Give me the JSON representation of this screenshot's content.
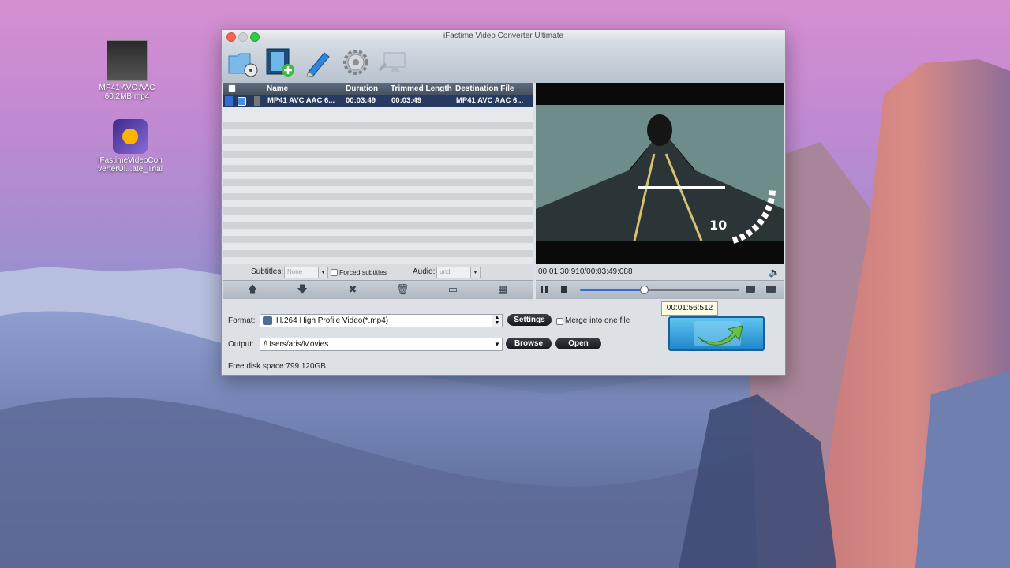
{
  "desktop": {
    "icons": [
      {
        "label": "MP41 AVC AAC\n60.2MB.mp4"
      },
      {
        "label": "iFastimeVideoCon\nverterUl...ate_Trial"
      }
    ]
  },
  "window": {
    "title": "iFastime Video Converter Ultimate",
    "toolbar": [
      {
        "name": "add-folder-icon"
      },
      {
        "name": "add-video-icon"
      },
      {
        "name": "edit-pencil-icon"
      },
      {
        "name": "settings-gear-icon"
      },
      {
        "name": "monitor-icon"
      }
    ],
    "list": {
      "columns": [
        "Name",
        "Duration",
        "Trimmed Length",
        "Destination File"
      ],
      "rows": [
        {
          "name": "MP41 AVC AAC 6...",
          "duration": "00:03:49",
          "trimmed": "00:03:49",
          "destination": "MP41 AVC AAC 6..."
        }
      ]
    },
    "subtitles": {
      "label": "Subtitles:",
      "value": "None",
      "forced_label": "Forced subtitles"
    },
    "audio": {
      "label": "Audio:",
      "value": "und"
    },
    "list_tools": [
      {
        "name": "move-up-icon",
        "glyph": "🡅"
      },
      {
        "name": "move-down-icon",
        "glyph": "🡇"
      },
      {
        "name": "remove-icon",
        "glyph": "✖"
      },
      {
        "name": "trash-icon",
        "glyph": "🗑"
      },
      {
        "name": "comment-icon",
        "glyph": "▭"
      },
      {
        "name": "grid-icon",
        "glyph": "▦"
      }
    ],
    "preview": {
      "time": "00:01:30:910/00:03:49:088",
      "progress": 0.4,
      "tooltip": "00:01:56:512"
    },
    "output": {
      "format_label": "Format:",
      "format_value": "H.264 High Profile Video(*.mp4)",
      "settings_button": "Settings",
      "merge_label": "Merge into one file",
      "output_label": "Output:",
      "output_value": "/Users/aris/Movies",
      "browse_button": "Browse",
      "open_button": "Open",
      "disk_space": "Free disk space:799.120GB"
    }
  }
}
